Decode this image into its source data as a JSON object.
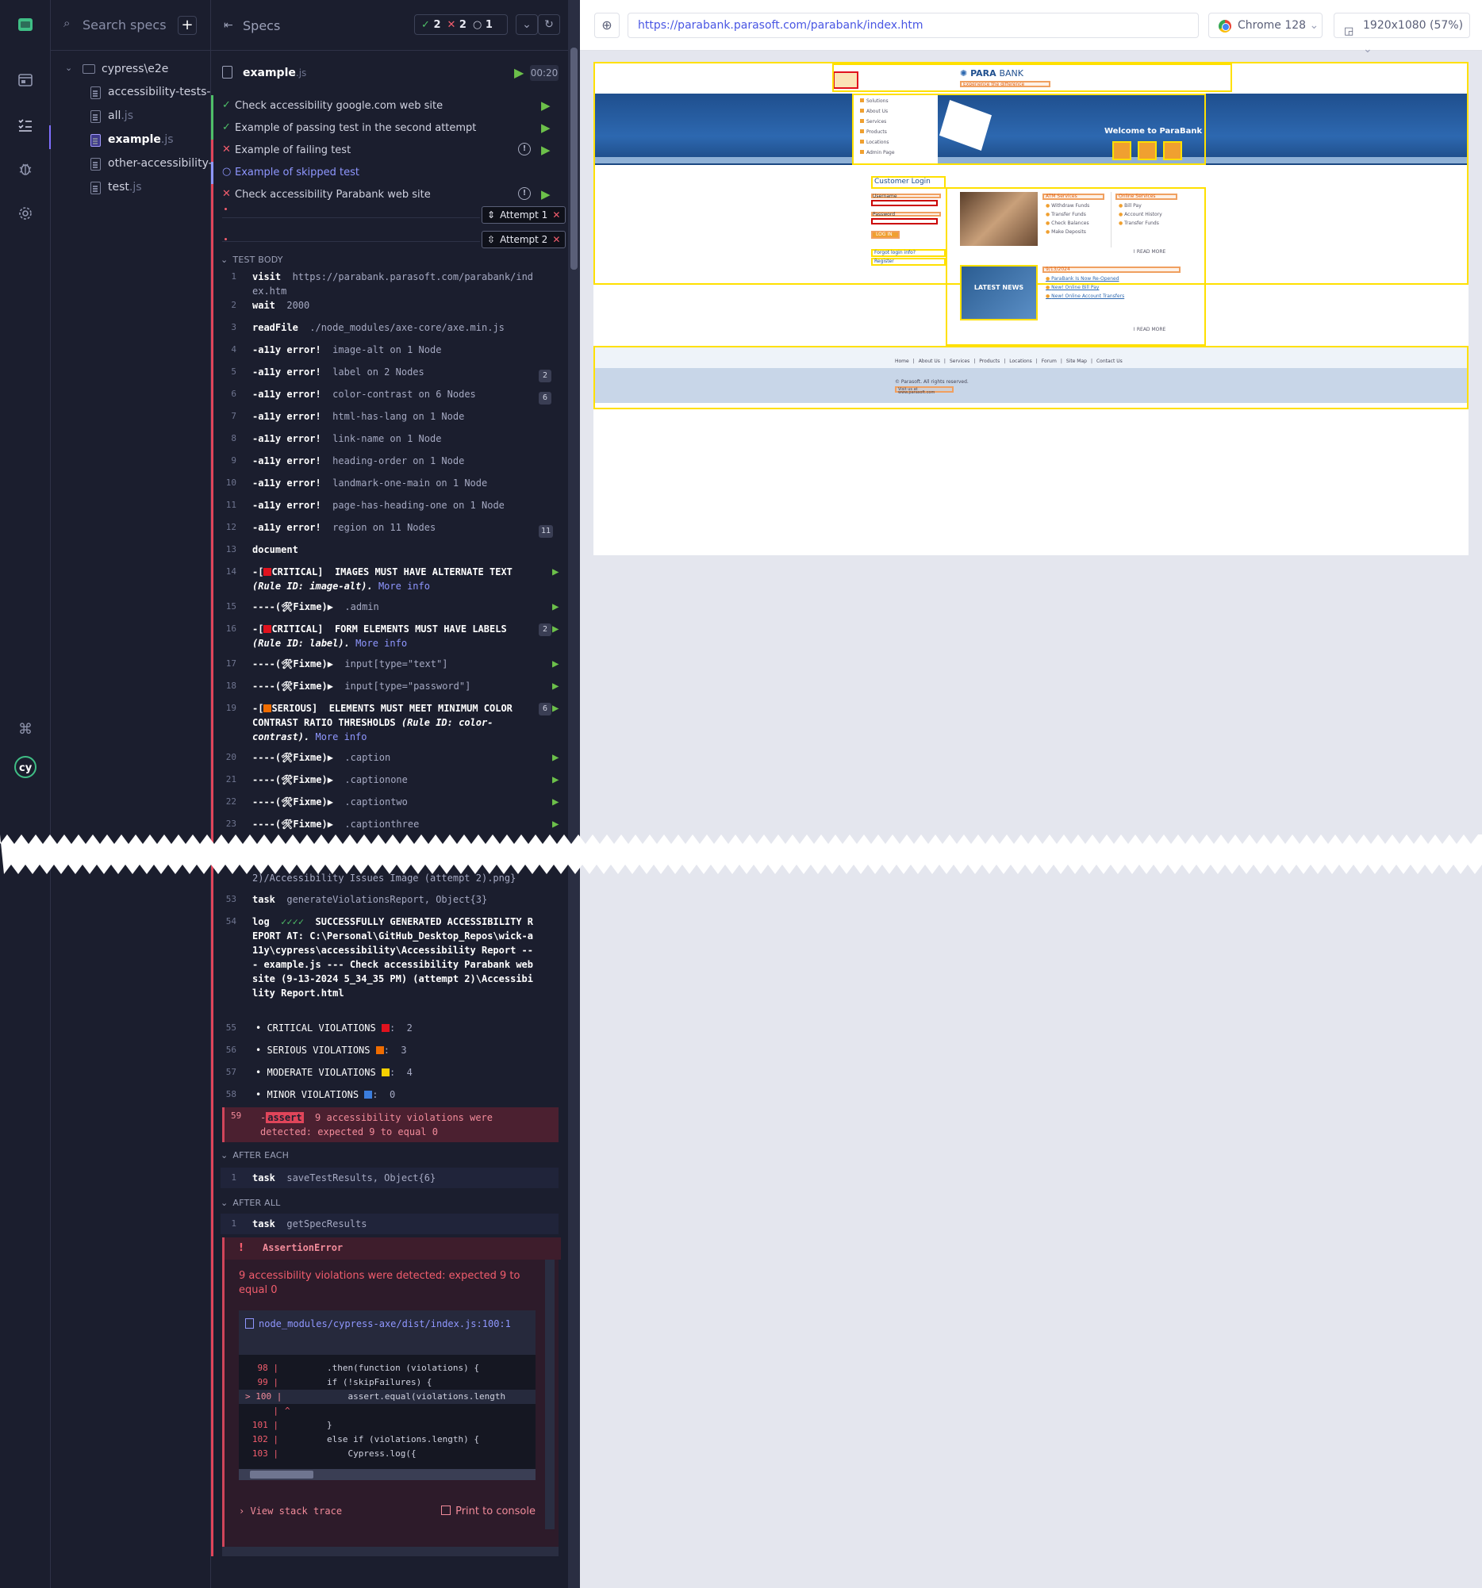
{
  "sidebar": {
    "search_placeholder": "Search specs",
    "folder": "cypress\\e2e",
    "files": [
      {
        "name": "accessibility-tests-…",
        "ext": ""
      },
      {
        "name": "all",
        "ext": ".js"
      },
      {
        "name": "example",
        "ext": ".js"
      },
      {
        "name": "other-accessibility-…",
        "ext": ""
      },
      {
        "name": "test",
        "ext": ".js"
      }
    ]
  },
  "reporter": {
    "title": "Specs",
    "stats": {
      "passed": "2",
      "failed": "2",
      "skipped": "1"
    },
    "spec_name": "example",
    "spec_ext": ".js",
    "duration": "00:20",
    "tests": [
      {
        "status": "pass",
        "title": "Check accessibility google.com web site"
      },
      {
        "status": "pass",
        "title": "Example of passing test in the second attempt"
      },
      {
        "status": "fail",
        "title": "Example of failing test"
      },
      {
        "status": "skip",
        "title": "Example of skipped test"
      },
      {
        "status": "fail",
        "title": "Check accessibility Parabank web site"
      }
    ],
    "attempts": [
      "Attempt 1",
      "Attempt 2"
    ],
    "sections": {
      "test_body": "TEST BODY",
      "after_each": "AFTER EACH",
      "after_all": "AFTER ALL"
    },
    "commands": [
      {
        "n": "1",
        "k": "visit",
        "v": "https://parabank.parasoft.com/parabank/index.htm"
      },
      {
        "n": "2",
        "k": "wait",
        "v": "2000"
      },
      {
        "n": "3",
        "k": "readFile",
        "v": "./node_modules/axe-core/axe.min.js"
      },
      {
        "n": "4",
        "k": "-a11y error!",
        "v": "image-alt on 1 Node"
      },
      {
        "n": "5",
        "k": "-a11y error!",
        "v": "label on 2 Nodes",
        "badge": "2"
      },
      {
        "n": "6",
        "k": "-a11y error!",
        "v": "color-contrast on 6 Nodes",
        "badge": "6"
      },
      {
        "n": "7",
        "k": "-a11y error!",
        "v": "html-has-lang on 1 Node"
      },
      {
        "n": "8",
        "k": "-a11y error!",
        "v": "link-name on 1 Node"
      },
      {
        "n": "9",
        "k": "-a11y error!",
        "v": "heading-order on 1 Node"
      },
      {
        "n": "10",
        "k": "-a11y error!",
        "v": "landmark-one-main on 1 Node"
      },
      {
        "n": "11",
        "k": "-a11y error!",
        "v": "page-has-heading-one on 1 Node"
      },
      {
        "n": "12",
        "k": "-a11y error!",
        "v": "region on 11 Nodes",
        "badge": "11"
      },
      {
        "n": "13",
        "k": "document",
        "v": ""
      }
    ],
    "violation_cmds": [
      {
        "n": "14",
        "pre": "-[",
        "sev": "CRITICAL]",
        "title": "IMAGES MUST HAVE ALTERNATE TEXT",
        "rule": "(Rule ID: image-alt).",
        "more": "More info"
      },
      {
        "n": "15",
        "fix": "----(🛠Fixme)▶",
        "sel": ".admin"
      },
      {
        "n": "16",
        "pre": "-[",
        "sev": "CRITICAL]",
        "title": "FORM ELEMENTS MUST HAVE LABELS",
        "rule": "(Rule ID: label).",
        "more": "More info",
        "badge": "2"
      },
      {
        "n": "17",
        "fix": "----(🛠Fixme)▶",
        "sel": "input[type=\"text\"]"
      },
      {
        "n": "18",
        "fix": "----(🛠Fixme)▶",
        "sel": "input[type=\"password\"]"
      },
      {
        "n": "19",
        "pre": "-[",
        "sev": "SERIOUS]",
        "title": "ELEMENTS MUST MEET MINIMUM COLOR CONTRAST RATIO THRESHOLDS",
        "rule": "(Rule ID: color-contrast).",
        "more": "More info",
        "badge": "6"
      },
      {
        "n": "20",
        "fix": "----(🛠Fixme)▶",
        "sel": ".caption"
      },
      {
        "n": "21",
        "fix": "----(🛠Fixme)▶",
        "sel": ".captionone"
      },
      {
        "n": "22",
        "fix": "----(🛠Fixme)▶",
        "sel": ".captiontwo"
      },
      {
        "n": "23",
        "fix": "----(🛠Fixme)▶",
        "sel": ".captionthree"
      }
    ],
    "tail_partial": "2)/Accessibility Issues Image (attempt 2).png}",
    "cmd53": {
      "n": "53",
      "k": "task",
      "v": "generateViolationsReport, Object{3}"
    },
    "cmd54": {
      "n": "54",
      "k": "log",
      "checks": "✓✓✓✓",
      "v": "SUCCESSFULLY GENERATED ACCESSIBILITY REPORT AT: C:\\Personal\\GitHub_Desktop_Repos\\wick-a11y\\cypress\\accessibility\\Accessibility Report --- example.js --- Check accessibility Parabank web site (9-13-2024 5_34_35 PM) (attempt 2)\\Accessibility Report.html"
    },
    "summary": [
      {
        "n": "55",
        "label": "• CRITICAL VIOLATIONS",
        "color": "#e0121e",
        "count": "2"
      },
      {
        "n": "56",
        "label": "• SERIOUS VIOLATIONS",
        "color": "#ef6c00",
        "count": "3"
      },
      {
        "n": "57",
        "label": "• MODERATE VIOLATIONS",
        "color": "#f5d000",
        "count": "4"
      },
      {
        "n": "58",
        "label": "• MINOR VIOLATIONS",
        "color": "#3b7ddd",
        "count": "0"
      }
    ],
    "assert_cmd": {
      "n": "59",
      "tag": "assert",
      "text": "9 accessibility violations were detected: expected 9 to equal 0"
    },
    "after_each_cmd": {
      "n": "1",
      "k": "task",
      "v": "saveTestResults, Object{6}"
    },
    "after_all_cmd": {
      "n": "1",
      "k": "task",
      "v": "getSpecResults"
    },
    "error": {
      "name": "AssertionError",
      "message": "9 accessibility violations were detected: expected 9 to equal 0",
      "file": "node_modules/cypress-axe/dist/index.js:100:1",
      "code": [
        {
          "n": "98 |",
          "c": "        .then(function (violations) {"
        },
        {
          "n": "99 |",
          "c": "        if (!skipFailures) {"
        },
        {
          "n": "> 100 |",
          "c": "            assert.equal(violations.length",
          "hl": true
        },
        {
          "n": "|",
          "c": "^"
        },
        {
          "n": "101 |",
          "c": "        }"
        },
        {
          "n": "102 |",
          "c": "        else if (violations.length) {"
        },
        {
          "n": "103 |",
          "c": "            Cypress.log({"
        }
      ],
      "stack_label": "View stack trace",
      "print_label": "Print to console"
    }
  },
  "aut": {
    "url": "https://parabank.parasoft.com/parabank/index.htm",
    "browser": "Chrome 128",
    "viewport": "1920x1080 (57%)"
  },
  "site": {
    "logo_a": "PARA",
    "logo_b": "BANK",
    "tagline": "Experience the difference",
    "nav": [
      "Solutions",
      "About Us",
      "Services",
      "Products",
      "Locations",
      "Admin Page"
    ],
    "welcome": "Welcome to ParaBank",
    "login_title": "Customer Login",
    "username": "Username",
    "password": "Password",
    "login_btn": "LOG IN",
    "forgot": "Forgot login info?",
    "register": "Register",
    "atm_title": "ATM Services",
    "atm": [
      "Withdraw Funds",
      "Transfer Funds",
      "Check Balances",
      "Make Deposits"
    ],
    "online_title": "Online Services",
    "online": [
      "Bill Pay",
      "Account History",
      "Transfer Funds"
    ],
    "read_more": "READ MORE",
    "latest_news": "LATEST NEWS",
    "news_date": "9/13/2024",
    "news": [
      "ParaBank Is Now Re-Opened",
      "New! Online Bill Pay",
      "New! Online Account Transfers"
    ],
    "footer_links": [
      "Home",
      "About Us",
      "Services",
      "Products",
      "Locations",
      "Forum",
      "Site Map",
      "Contact Us"
    ],
    "copyright": "© Parasoft. All rights reserved.",
    "visit": "Visit us at www.parasoft.com"
  }
}
